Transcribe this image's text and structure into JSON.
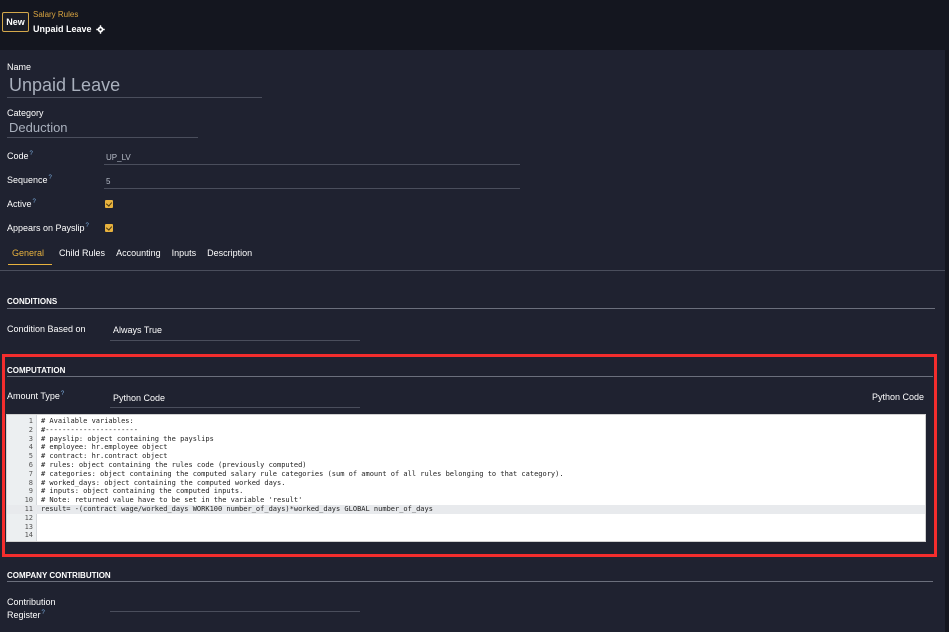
{
  "header": {
    "new_label": "New",
    "breadcrumb_parent": "Salary Rules",
    "breadcrumb_current": "Unpaid Leave"
  },
  "form": {
    "name_label": "Name",
    "name_value": "Unpaid Leave",
    "category_label": "Category",
    "category_value": "Deduction",
    "code_label": "Code",
    "code_value": "UP_LV",
    "sequence_label": "Sequence",
    "sequence_value": "5",
    "active_label": "Active",
    "active_checked": true,
    "appears_label": "Appears on Payslip",
    "appears_checked": true,
    "help_mark": "?"
  },
  "tabs": [
    {
      "label": "General",
      "active": true
    },
    {
      "label": "Child Rules",
      "active": false
    },
    {
      "label": "Accounting",
      "active": false
    },
    {
      "label": "Inputs",
      "active": false
    },
    {
      "label": "Description",
      "active": false
    }
  ],
  "conditions": {
    "title": "CONDITIONS",
    "condition_label": "Condition Based on",
    "condition_value": "Always True"
  },
  "computation": {
    "title": "COMPUTATION",
    "amount_type_label": "Amount Type",
    "amount_type_value": "Python Code",
    "python_code_label": "Python Code",
    "code_lines": [
      "# Available variables:",
      "#----------------------",
      "# payslip: object containing the payslips",
      "# employee: hr.employee object",
      "# contract: hr.contract object",
      "# rules: object containing the rules code (previously computed)",
      "# categories: object containing the computed salary rule categories (sum of amount of all rules belonging to that category).",
      "# worked_days: object containing the computed worked days.",
      "# inputs: object containing the computed inputs.",
      "# Note: returned value have to be set in the variable 'result'",
      "result= -(contract wage/worked_days WORK100 number_of_days)*worked_days GLOBAL number_of_days",
      "",
      "",
      ""
    ],
    "active_line": 11
  },
  "company": {
    "title": "COMPANY CONTRIBUTION",
    "register_label_1": "Contribution",
    "register_label_2": "Register"
  },
  "colors": {
    "accent": "#e8b23e",
    "highlight_box": "#f32d2d",
    "background": "#1f2230"
  }
}
